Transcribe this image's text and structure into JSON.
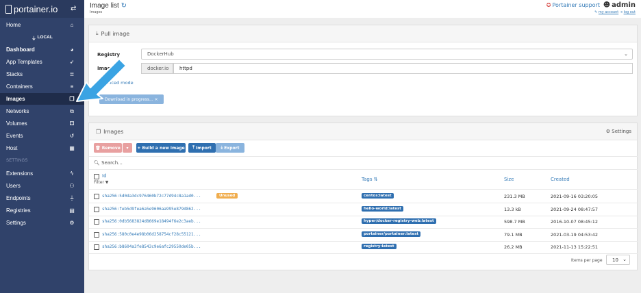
{
  "sidebar": {
    "brand": "portainer.io",
    "endpoint": "LOCAL",
    "items": [
      {
        "label": "Home",
        "icon": "home-icon",
        "glyph": "⌂"
      },
      {
        "label": "Dashboard",
        "icon": "dashboard-icon",
        "glyph": "◕"
      },
      {
        "label": "App Templates",
        "icon": "rocket-icon",
        "glyph": "➶"
      },
      {
        "label": "Stacks",
        "icon": "list-icon",
        "glyph": "≣"
      },
      {
        "label": "Containers",
        "icon": "server-icon",
        "glyph": "≡"
      },
      {
        "label": "Images",
        "icon": "clone-icon",
        "glyph": "❐"
      },
      {
        "label": "Networks",
        "icon": "sitemap-icon",
        "glyph": "⧉"
      },
      {
        "label": "Volumes",
        "icon": "cubes-icon",
        "glyph": "⚃"
      },
      {
        "label": "Events",
        "icon": "history-icon",
        "glyph": "↺"
      },
      {
        "label": "Host",
        "icon": "th-icon",
        "glyph": "▦"
      },
      {
        "label": "SETTINGS"
      },
      {
        "label": "Extensions",
        "icon": "bolt-icon",
        "glyph": "ϟ"
      },
      {
        "label": "Users",
        "icon": "users-icon",
        "glyph": "⚇"
      },
      {
        "label": "Endpoints",
        "icon": "plug-icon",
        "glyph": "⏚"
      },
      {
        "label": "Registries",
        "icon": "database-icon",
        "glyph": "▤"
      },
      {
        "label": "Settings",
        "icon": "cogs-icon",
        "glyph": "⚙"
      }
    ]
  },
  "header": {
    "title": "Image list",
    "subtitle": "Images",
    "support": "Portainer support",
    "user": "admin",
    "my_account": "my account",
    "log_out": "log out"
  },
  "pull": {
    "heading": "Pull image",
    "registry_label": "Registry",
    "registry_value": "DockerHub",
    "image_label": "Image",
    "image_prefix": "docker.io",
    "image_value": "httpd",
    "advanced": "Advanced mode",
    "download_button": "Download in progress...  ×"
  },
  "images": {
    "heading": "Images",
    "settings": "Settings",
    "remove": "Remove",
    "build": "+ Build a new image",
    "import": "Import",
    "export": "Export",
    "search_placeholder": "Search...",
    "columns": {
      "id": "Id",
      "filter": "Filter",
      "tags": "Tags ⇅",
      "size": "Size",
      "created": "Created"
    },
    "rows": [
      {
        "id": "sha256:5d0da3dc976460b72c77d94c8a1ad0...",
        "badge": "Unused",
        "tag": "centos:latest",
        "size": "231.3 MB",
        "created": "2021-09-16 03:20:05"
      },
      {
        "id": "sha256:feb5d9fea6a5e9606aa995e879d862...",
        "badge": "",
        "tag": "hello-world:latest",
        "size": "13.3 kB",
        "created": "2021-09-24 08:47:57"
      },
      {
        "id": "sha256:0db5683824d8669e18494f6e2c3aeb...",
        "badge": "",
        "tag": "hyper/docker-registry-web:latest",
        "size": "598.7 MB",
        "created": "2016-10-07 08:45:12"
      },
      {
        "id": "sha256:580c0e4e98b06d258754cf28c55121...",
        "badge": "",
        "tag": "portainer/portainer:latest",
        "size": "79.1 MB",
        "created": "2021-03-19 04:53:42"
      },
      {
        "id": "sha256:b8604a3fe8543c9e6afc29550de05b...",
        "badge": "",
        "tag": "registry:latest",
        "size": "26.2 MB",
        "created": "2021-11-13 15:22:51"
      }
    ],
    "items_per_page_label": "Items per page",
    "items_per_page": "10"
  },
  "colors": {
    "sidebar": "#30426a",
    "accent": "#337ab7",
    "tag": "#2f6fb0",
    "unused": "#f0ad4e",
    "arrow": "#3aa3e3"
  }
}
